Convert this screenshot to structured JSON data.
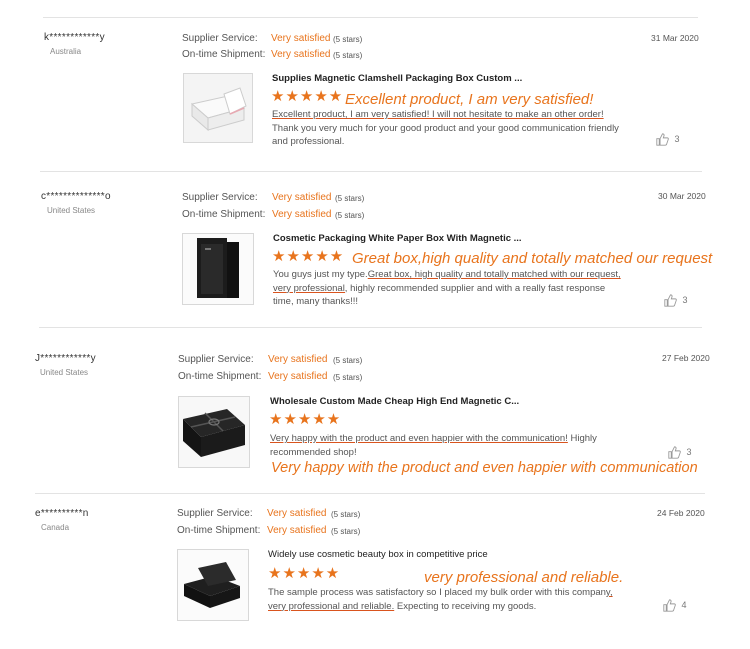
{
  "reviews": [
    {
      "user": "k************y",
      "country": "Australia",
      "supplier_service_label": "Supplier Service:",
      "supplier_service_value": "Very satisfied",
      "supplier_service_stars": "(5 stars)",
      "shipment_label": "On-time Shipment:",
      "shipment_value": "Very satisfied",
      "shipment_stars": "(5 stars)",
      "date": "31 Mar 2020",
      "product_title": "Supplies Magnetic Clamshell Packaging Box Custom ...",
      "rating_stars": "★★★★★",
      "callout": "Excellent product, I am very satisfied!",
      "text_highlight": "Excellent product, I am very satisfied! I will not hesitate to make an other order!",
      "text_rest": " Thank you very much for your good product and your good communication friendly and professional.",
      "likes": "3",
      "image_icon": "white-box-image"
    },
    {
      "user": "c**************o",
      "country": "United States",
      "supplier_service_label": "Supplier Service:",
      "supplier_service_value": "Very satisfied",
      "supplier_service_stars": "(5 stars)",
      "shipment_label": "On-time Shipment:",
      "shipment_value": "Very satisfied",
      "shipment_stars": "(5 stars)",
      "date": "30 Mar 2020",
      "product_title": "Cosmetic Packaging White Paper Box With Magnetic ...",
      "rating_stars": "★★★★★",
      "callout": "Great box,high quality and totally matched our request",
      "text_prefix": "You guys just my type.",
      "text_highlight": "Great box, high quality and totally matched with our request, very professional,",
      "text_rest": " highly recommended supplier and with a really fast response time, many thanks!!!",
      "likes": "3",
      "image_icon": "black-box-image"
    },
    {
      "user": "J************y",
      "country": "United States",
      "supplier_service_label": "Supplier Service:",
      "supplier_service_value": "Very satisfied",
      "supplier_service_stars": "(5 stars)",
      "shipment_label": "On-time Shipment:",
      "shipment_value": "Very satisfied",
      "shipment_stars": "(5 stars)",
      "date": "27 Feb 2020",
      "product_title": "Wholesale Custom Made Cheap High End Magnetic C...",
      "rating_stars": "★★★★★",
      "callout": "Very happy with the product and even happier with communication",
      "text_highlight": "Very happy with the product and even happier with the communication!",
      "text_rest": " Highly recommended shop!",
      "likes": "3",
      "image_icon": "ribbon-box-image"
    },
    {
      "user": "e**********n",
      "country": "Canada",
      "supplier_service_label": "Supplier Service:",
      "supplier_service_value": "Very satisfied",
      "supplier_service_stars": "(5 stars)",
      "shipment_label": "On-time Shipment:",
      "shipment_value": "Very satisfied",
      "shipment_stars": "(5 stars)",
      "date": "24 Feb 2020",
      "product_title": "Widely use cosmetic beauty box in competitive price",
      "rating_stars": "★★★★★",
      "callout": "very professional and reliable.",
      "text_prefix": "The sample process was satisfactory so I placed my bulk order with this compan",
      "text_highlight": "y, very professional and reliable.",
      "text_rest": " Expecting to receiving my goods.",
      "likes": "4",
      "image_icon": "black-box-image"
    }
  ],
  "colors": {
    "accent": "#e8741d",
    "underline": "#d9541e"
  }
}
